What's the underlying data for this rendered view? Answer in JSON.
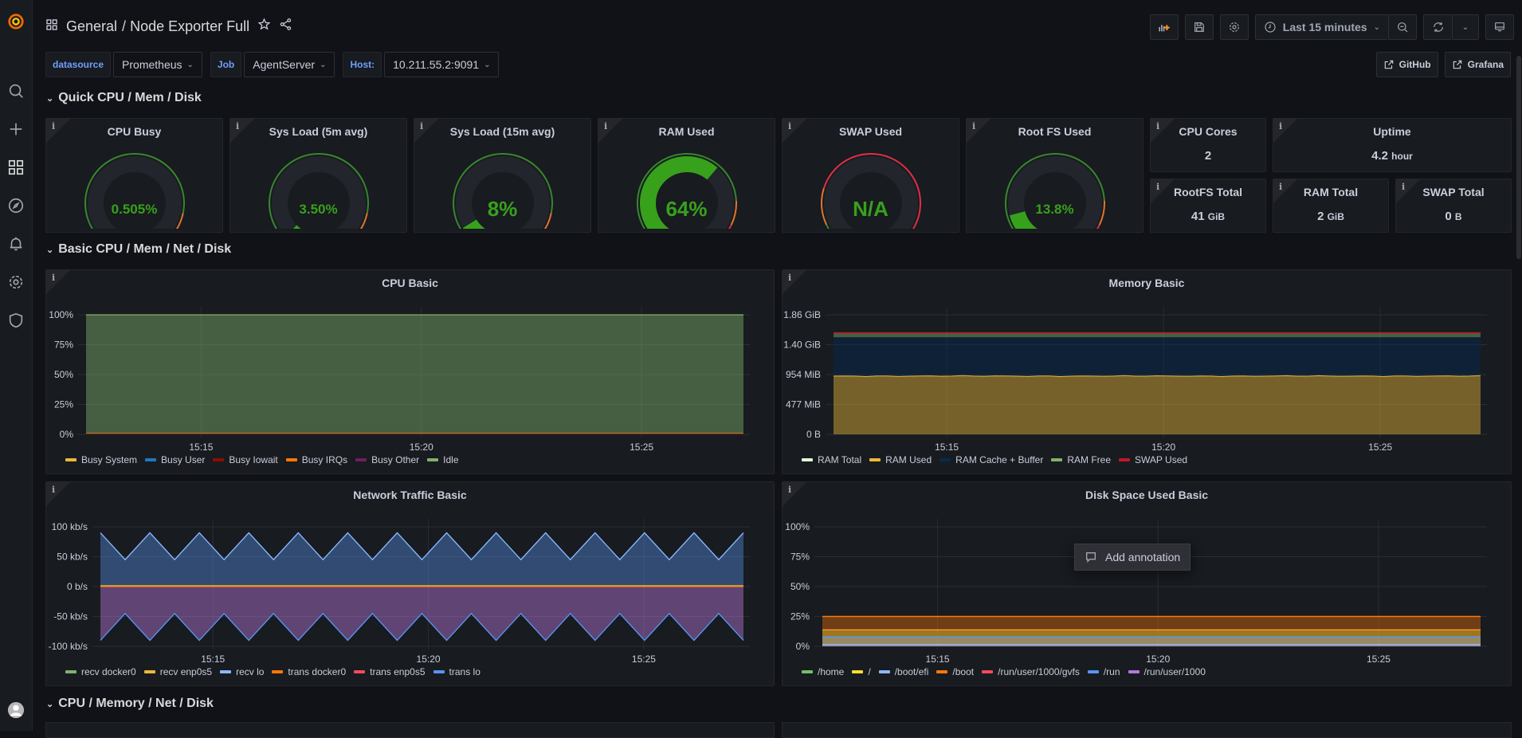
{
  "sidebar": {
    "items": [
      {
        "name": "grafana-logo"
      },
      {
        "name": "search"
      },
      {
        "name": "create"
      },
      {
        "name": "dashboards"
      },
      {
        "name": "explore"
      },
      {
        "name": "alerting"
      },
      {
        "name": "configuration"
      },
      {
        "name": "server-admin"
      },
      {
        "name": "profile"
      }
    ]
  },
  "header": {
    "folder": "General",
    "separator": "/",
    "dashboard": "Node Exporter Full",
    "time_range": "Last 15 minutes"
  },
  "variables": [
    {
      "label": "datasource",
      "value": "Prometheus"
    },
    {
      "label": "Job",
      "value": "AgentServer"
    },
    {
      "label": "Host:",
      "value": "10.211.55.2:9091"
    }
  ],
  "links": [
    {
      "label": "GitHub"
    },
    {
      "label": "Grafana"
    }
  ],
  "rows": [
    {
      "title": "Quick CPU / Mem / Disk"
    },
    {
      "title": "Basic CPU / Mem / Net / Disk"
    },
    {
      "title": "CPU / Memory / Net / Disk"
    }
  ],
  "gauges": [
    {
      "title": "CPU Busy",
      "value": "0.505%",
      "fraction": 0.00505,
      "thresholds": [
        0.85,
        0.95
      ]
    },
    {
      "title": "Sys Load (5m avg)",
      "value": "3.50%",
      "fraction": 0.035,
      "thresholds": [
        0.85,
        0.95
      ]
    },
    {
      "title": "Sys Load (15m avg)",
      "value": "8%",
      "fraction": 0.08,
      "thresholds": [
        0.85,
        0.95
      ]
    },
    {
      "title": "RAM Used",
      "value": "64%",
      "fraction": 0.64,
      "thresholds": [
        0.8,
        0.9
      ]
    },
    {
      "title": "SWAP Used",
      "value": "N/A",
      "fraction": 0,
      "thresholds": [
        0.1,
        0.25
      ]
    },
    {
      "title": "Root FS Used",
      "value": "13.8%",
      "fraction": 0.138,
      "thresholds": [
        0.8,
        0.9
      ]
    }
  ],
  "stats": [
    {
      "title": "CPU Cores",
      "value": "2",
      "unit": ""
    },
    {
      "title": "Uptime",
      "value": "4.2",
      "unit": "hour"
    },
    {
      "title": "RootFS Total",
      "value": "41",
      "unit": "GiB"
    },
    {
      "title": "RAM Total",
      "value": "2",
      "unit": "GiB"
    },
    {
      "title": "SWAP Total",
      "value": "0",
      "unit": "B"
    }
  ],
  "annotation_tooltip": "Add annotation",
  "chart_data": [
    {
      "type": "area",
      "title": "CPU Basic",
      "x_ticks": [
        "15:15",
        "15:20",
        "15:25"
      ],
      "y_ticks": [
        "0%",
        "25%",
        "50%",
        "75%",
        "100%"
      ],
      "ylim": [
        0,
        100
      ],
      "stacked": true,
      "series": [
        {
          "name": "Busy System",
          "color": "#EAB839",
          "value": 0.3
        },
        {
          "name": "Busy User",
          "color": "#1F78C1",
          "value": 0.2
        },
        {
          "name": "Busy Iowait",
          "color": "#890F02",
          "value": 0.05
        },
        {
          "name": "Busy IRQs",
          "color": "#FF780A",
          "value": 0
        },
        {
          "name": "Busy Other",
          "color": "#6D1F62",
          "value": 0
        },
        {
          "name": "Idle",
          "color": "#7EB26D",
          "value": 99.45
        }
      ]
    },
    {
      "type": "area",
      "title": "Memory Basic",
      "x_ticks": [
        "15:15",
        "15:20",
        "15:25"
      ],
      "y_ticks": [
        "0 B",
        "477 MiB",
        "954 MiB",
        "1.40 GiB",
        "1.86 GiB"
      ],
      "ylim_mib": [
        0,
        1908
      ],
      "stacked": true,
      "series": [
        {
          "name": "RAM Total",
          "color": "#E0F9D7",
          "value_mib": 1620
        },
        {
          "name": "RAM Used",
          "color": "#EAB839",
          "value_mib": 930
        },
        {
          "name": "RAM Cache + Buffer",
          "color": "#052B51",
          "value_mib": 620
        },
        {
          "name": "RAM Free",
          "color": "#7EB26D",
          "value_mib": 70
        },
        {
          "name": "SWAP Used",
          "color": "#C4162A",
          "value_mib": 0
        }
      ]
    },
    {
      "type": "area",
      "title": "Network Traffic Basic",
      "x_ticks": [
        "15:15",
        "15:20",
        "15:25"
      ],
      "y_ticks": [
        "-100 kb/s",
        "-50 kb/s",
        "0 b/s",
        "50 kb/s",
        "100 kb/s"
      ],
      "ylim": [
        -100,
        100
      ],
      "series": [
        {
          "name": "recv docker0",
          "color": "#7EB26D",
          "value_kbps": 1
        },
        {
          "name": "recv enp0s5",
          "color": "#EAB839",
          "value_kbps": 2
        },
        {
          "name": "recv lo",
          "color": "#8AB8FF",
          "range_kbps": [
            45,
            90
          ]
        },
        {
          "name": "trans docker0",
          "color": "#FF780A",
          "value_kbps": -0.5
        },
        {
          "name": "trans enp0s5",
          "color": "#F2495C",
          "value_kbps": -1
        },
        {
          "name": "trans lo",
          "color": "#5794F2",
          "range_kbps": [
            -90,
            -45
          ]
        }
      ]
    },
    {
      "type": "area",
      "title": "Disk Space Used Basic",
      "x_ticks": [
        "15:15",
        "15:20",
        "15:25"
      ],
      "y_ticks": [
        "0%",
        "25%",
        "50%",
        "75%",
        "100%"
      ],
      "ylim": [
        0,
        100
      ],
      "series": [
        {
          "name": "/home",
          "color": "#73BF69",
          "value": 0
        },
        {
          "name": "/",
          "color": "#FADE2A",
          "value": 13.8
        },
        {
          "name": "/boot/efi",
          "color": "#8AB8FF",
          "value": 1.5
        },
        {
          "name": "/boot",
          "color": "#FF780A",
          "value": 25
        },
        {
          "name": "/run/user/1000/gvfs",
          "color": "#F2495C",
          "value": 0
        },
        {
          "name": "/run",
          "color": "#5794F2",
          "value": 8
        },
        {
          "name": "/run/user/1000",
          "color": "#B877D9",
          "value": 0.5
        }
      ]
    }
  ]
}
